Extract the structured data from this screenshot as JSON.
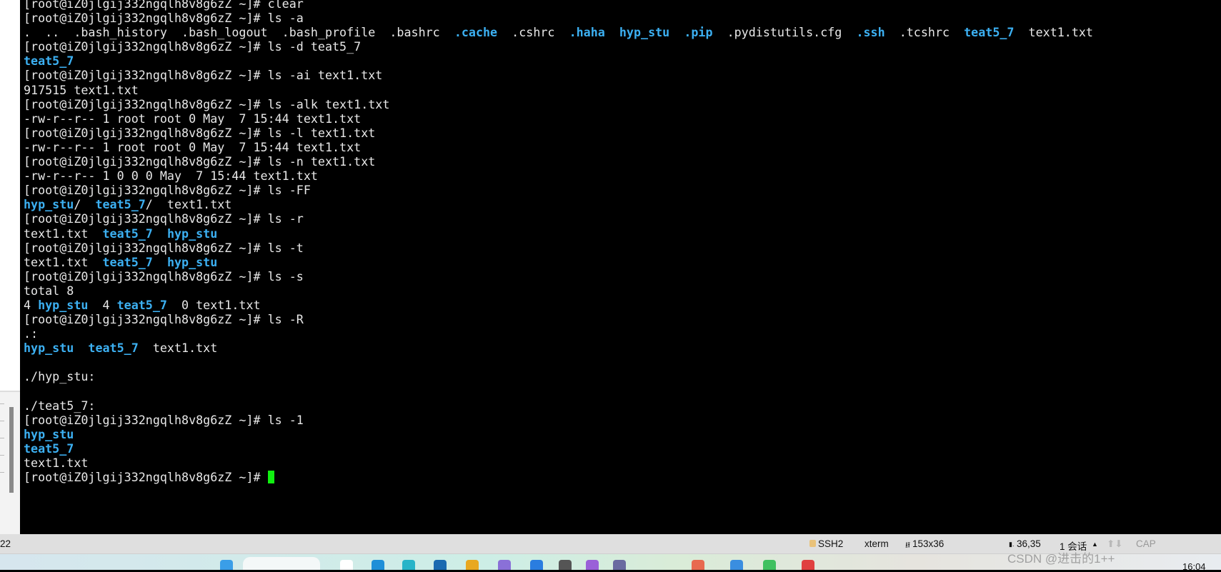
{
  "terminal": {
    "colors": {
      "background": "#000000",
      "text": "#e8e8e8",
      "directory": "#3cb0f2",
      "cursor": "#10f010"
    },
    "lines": [
      [
        {
          "t": "[root@iZ0jlgij332ngqlh8v8g6zZ ~]# clear"
        }
      ],
      [
        {
          "t": "[root@iZ0jlgij332ngqlh8v8g6zZ ~]# ls -a"
        }
      ],
      [
        {
          "t": ".  ..  .bash_history  .bash_logout  .bash_profile  .bashrc  "
        },
        {
          "t": ".cache",
          "d": true
        },
        {
          "t": "  .cshrc  "
        },
        {
          "t": ".haha",
          "d": true
        },
        {
          "t": "  "
        },
        {
          "t": "hyp_stu",
          "d": true
        },
        {
          "t": "  "
        },
        {
          "t": ".pip",
          "d": true
        },
        {
          "t": "  .pydistutils.cfg  "
        },
        {
          "t": ".ssh",
          "d": true
        },
        {
          "t": "  .tcshrc  "
        },
        {
          "t": "teat5_7",
          "d": true
        },
        {
          "t": "  text1.txt"
        }
      ],
      [
        {
          "t": "[root@iZ0jlgij332ngqlh8v8g6zZ ~]# ls -d teat5_7"
        }
      ],
      [
        {
          "t": "teat5_7",
          "d": true
        }
      ],
      [
        {
          "t": "[root@iZ0jlgij332ngqlh8v8g6zZ ~]# ls -ai text1.txt"
        }
      ],
      [
        {
          "t": "917515 text1.txt"
        }
      ],
      [
        {
          "t": "[root@iZ0jlgij332ngqlh8v8g6zZ ~]# ls -alk text1.txt"
        }
      ],
      [
        {
          "t": "-rw-r--r-- 1 root root 0 May  7 15:44 text1.txt"
        }
      ],
      [
        {
          "t": "[root@iZ0jlgij332ngqlh8v8g6zZ ~]# ls -l text1.txt"
        }
      ],
      [
        {
          "t": "-rw-r--r-- 1 root root 0 May  7 15:44 text1.txt"
        }
      ],
      [
        {
          "t": "[root@iZ0jlgij332ngqlh8v8g6zZ ~]# ls -n text1.txt"
        }
      ],
      [
        {
          "t": "-rw-r--r-- 1 0 0 0 May  7 15:44 text1.txt"
        }
      ],
      [
        {
          "t": "[root@iZ0jlgij332ngqlh8v8g6zZ ~]# ls -FF"
        }
      ],
      [
        {
          "t": "hyp_stu",
          "d": true
        },
        {
          "t": "/  "
        },
        {
          "t": "teat5_7",
          "d": true
        },
        {
          "t": "/  text1.txt"
        }
      ],
      [
        {
          "t": "[root@iZ0jlgij332ngqlh8v8g6zZ ~]# ls -r"
        }
      ],
      [
        {
          "t": "text1.txt  "
        },
        {
          "t": "teat5_7",
          "d": true
        },
        {
          "t": "  "
        },
        {
          "t": "hyp_stu",
          "d": true
        }
      ],
      [
        {
          "t": "[root@iZ0jlgij332ngqlh8v8g6zZ ~]# ls -t"
        }
      ],
      [
        {
          "t": "text1.txt  "
        },
        {
          "t": "teat5_7",
          "d": true
        },
        {
          "t": "  "
        },
        {
          "t": "hyp_stu",
          "d": true
        }
      ],
      [
        {
          "t": "[root@iZ0jlgij332ngqlh8v8g6zZ ~]# ls -s"
        }
      ],
      [
        {
          "t": "total 8"
        }
      ],
      [
        {
          "t": "4 "
        },
        {
          "t": "hyp_stu",
          "d": true
        },
        {
          "t": "  4 "
        },
        {
          "t": "teat5_7",
          "d": true
        },
        {
          "t": "  0 text1.txt"
        }
      ],
      [
        {
          "t": "[root@iZ0jlgij332ngqlh8v8g6zZ ~]# ls -R"
        }
      ],
      [
        {
          "t": ".:"
        }
      ],
      [
        {
          "t": "hyp_stu",
          "d": true
        },
        {
          "t": "  "
        },
        {
          "t": "teat5_7",
          "d": true
        },
        {
          "t": "  text1.txt"
        }
      ],
      [],
      [
        {
          "t": "./hyp_stu:"
        }
      ],
      [],
      [
        {
          "t": "./teat5_7:"
        }
      ],
      [
        {
          "t": "[root@iZ0jlgij332ngqlh8v8g6zZ ~]# ls -1"
        }
      ],
      [
        {
          "t": "hyp_stu",
          "d": true
        }
      ],
      [
        {
          "t": "teat5_7",
          "d": true
        }
      ],
      [
        {
          "t": "text1.txt"
        }
      ],
      [
        {
          "t": "[root@iZ0jlgij332ngqlh8v8g6zZ ~]# "
        },
        {
          "cursor": true
        }
      ]
    ]
  },
  "statusbar": {
    "left_text": "22",
    "protocol": "SSH2",
    "protocol_icon": "lock-icon",
    "terminal_type": "xterm",
    "size": "153x36",
    "size_icon": "resize-icon",
    "cursor_pos": "36,35",
    "cursor_icon": "cursor-position-icon",
    "sessions": "1 会话",
    "sessions_arrow": "▲",
    "transfer_arrows": "⬆⬇",
    "caps": "CAP"
  },
  "taskbar": {
    "icons": [
      "windows-start-icon",
      "search-box",
      "file-icon",
      "edge-icon",
      "edge-dev-icon",
      "app-icon",
      "folder-icon",
      "visual-studio-icon",
      "store-icon",
      "game-icon",
      "vs-icon",
      "app-icon",
      "app-icon",
      "app-icon",
      "wechat-icon",
      "pdf-icon"
    ],
    "clock": "16:04"
  },
  "watermark": "CSDN @进击的1++"
}
